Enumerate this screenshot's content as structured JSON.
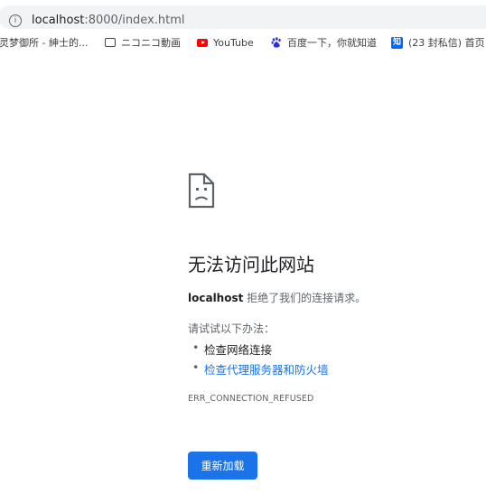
{
  "address_bar": {
    "url_host": "localhost",
    "url_rest": ":8000/index.html"
  },
  "bookmarks": [
    {
      "label": "灵梦御所 - 紳士的...",
      "icon": "none"
    },
    {
      "label": "ニコニコ動画",
      "icon": "nicovideo-icon"
    },
    {
      "label": "YouTube",
      "icon": "youtube-icon"
    },
    {
      "label": "百度一下，你就知道",
      "icon": "baidu-icon"
    },
    {
      "label": "(23 封私信) 首页",
      "icon": "zhihu-icon"
    }
  ],
  "error": {
    "title": "无法访问此网站",
    "host": "localhost",
    "description_rest": " 拒绝了我们的连接请求。",
    "try_label": "请试试以下办法：",
    "suggestions": [
      "检查网络连接",
      "检查代理服务器和防火墙"
    ],
    "code": "ERR_CONNECTION_REFUSED",
    "reload_label": "重新加载"
  },
  "colors": {
    "accent": "#1a73e8",
    "youtube": "#ff0000",
    "zhihu": "#0066ff"
  }
}
